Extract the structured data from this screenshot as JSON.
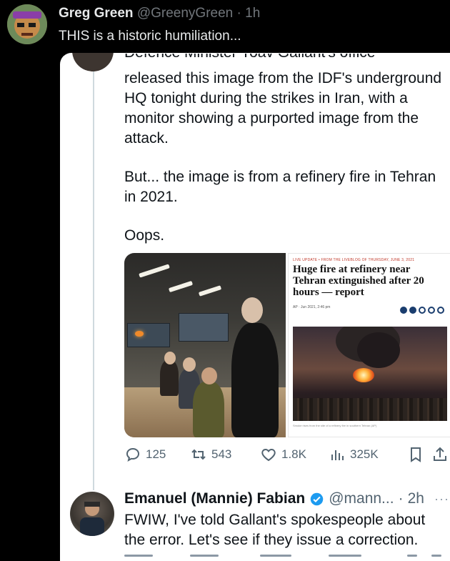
{
  "outer_tweet": {
    "display_name": "Greg Green",
    "handle": "@GreenyGreen",
    "separator": "·",
    "time": "1h",
    "text": "THIS is a historic humiliation..."
  },
  "quoted": {
    "cut_off_line": "Defence Minister Yoav Gallant's office",
    "paragraphs": [
      "released this image from the IDF's underground HQ tonight during the strikes in Iran, with a monitor showing a purported image from the attack.",
      "But... the image is from a refinery fire in Tehran in 2021.",
      "Oops."
    ],
    "news_clip": {
      "meta": "LIVE UPDATE • FROM THE LIVEBLOG OF THURSDAY, JUNE 3, 2021",
      "headline": "Huge fire at refinery near Tehran extinguished after 20 hours — report",
      "byline": "AP · Jun 2021, 2:46 pm",
      "caption": "Smoke rises from the site of a refinery fire in southern Tehran (AP)"
    },
    "actions": {
      "replies": "125",
      "reposts": "543",
      "likes": "1.8K",
      "views": "325K"
    }
  },
  "reply": {
    "display_name": "Emanuel (Mannie) Fabian",
    "handle": "@mann...",
    "separator": "·",
    "time": "2h",
    "text": "FWIW, I've told Gallant's spokespeople about the error. Let's see if they issue a correction."
  },
  "colors": {
    "background": "#000000",
    "card": "#ffffff",
    "muted": "#536471",
    "verified": "#1d9bf0"
  }
}
